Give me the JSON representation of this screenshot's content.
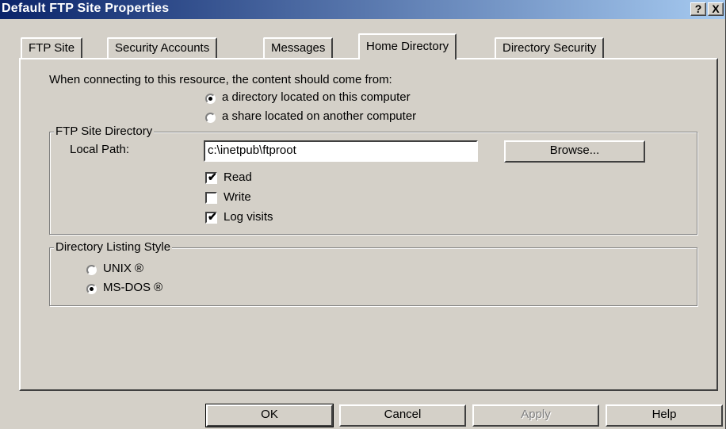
{
  "window": {
    "title": "Default FTP Site Properties",
    "help_btn": "?",
    "close_btn": "X"
  },
  "tabs": [
    {
      "label": "FTP Site"
    },
    {
      "label": "Security Accounts"
    },
    {
      "label": "Messages"
    },
    {
      "label": "Home Directory"
    },
    {
      "label": "Directory Security"
    }
  ],
  "home": {
    "prompt": "When connecting to this resource, the content should come from:",
    "source_options": [
      {
        "label": "a directory located on this computer",
        "selected": true
      },
      {
        "label": "a share located on another computer",
        "selected": false
      }
    ],
    "site_dir_group": "FTP Site Directory",
    "local_path_label": "Local Path:",
    "local_path_value": "c:\\inetpub\\ftproot",
    "browse_label": "Browse...",
    "permissions": [
      {
        "label": "Read",
        "checked": true
      },
      {
        "label": "Write",
        "checked": false
      },
      {
        "label": "Log visits",
        "checked": true
      }
    ],
    "listing_group": "Directory Listing Style",
    "listing_options": [
      {
        "label": "UNIX ®",
        "selected": false
      },
      {
        "label": "MS-DOS ®",
        "selected": true
      }
    ]
  },
  "footer": {
    "ok": "OK",
    "cancel": "Cancel",
    "apply": "Apply",
    "help": "Help"
  }
}
